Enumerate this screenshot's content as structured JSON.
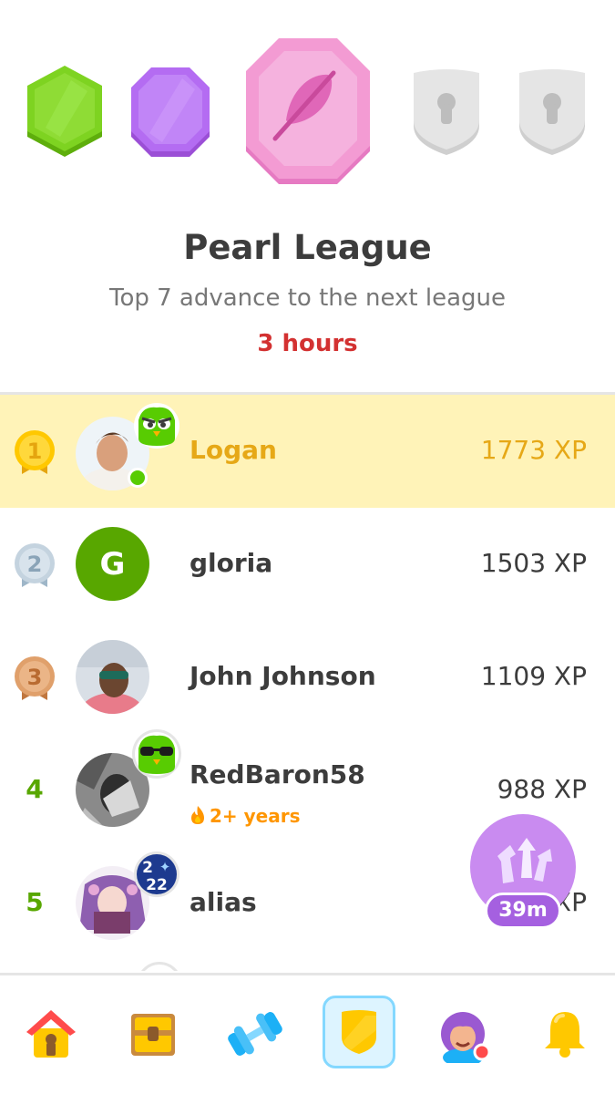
{
  "leagues": {
    "badges": [
      {
        "name": "emerald",
        "color": "#7ed321",
        "state": "completed"
      },
      {
        "name": "amethyst",
        "color": "#b46cf2",
        "state": "completed"
      },
      {
        "name": "pearl",
        "color": "#f39bd3",
        "state": "current",
        "icon": "feather-icon"
      },
      {
        "name": "locked-1",
        "color": "#e5e5e5",
        "state": "locked",
        "icon": "keyhole-icon"
      },
      {
        "name": "locked-2",
        "color": "#e5e5e5",
        "state": "locked",
        "icon": "keyhole-icon"
      }
    ]
  },
  "header": {
    "title": "Pearl League",
    "subtitle": "Top 7 advance to the next league",
    "time_left": "3 hours"
  },
  "leaderboard": [
    {
      "rank": "1",
      "rank_style": "gold-medal",
      "name": "Logan",
      "xp": "1773 XP",
      "is_me": true,
      "online": true,
      "badge": "duo-owl-icon"
    },
    {
      "rank": "2",
      "rank_style": "silver-medal",
      "name": "gloria",
      "xp": "1503 XP",
      "avatar_letter": "G",
      "avatar_color": "#58a700"
    },
    {
      "rank": "3",
      "rank_style": "bronze-medal",
      "name": "John Johnson",
      "xp": "1109 XP"
    },
    {
      "rank": "4",
      "name": "RedBaron58",
      "xp": "988 XP",
      "streak": "2+ years",
      "badge": "duo-sunglasses-icon"
    },
    {
      "rank": "5",
      "name": "alias",
      "xp": "XP",
      "badge": "year-2022-icon",
      "badge_text": [
        "2",
        "✦",
        "22"
      ]
    }
  ],
  "boost": {
    "label": "39m",
    "icon": "xp-boost-icon"
  },
  "nav": {
    "items": [
      {
        "name": "home",
        "icon": "house-icon"
      },
      {
        "name": "stories",
        "icon": "treasure-chest-icon"
      },
      {
        "name": "practice",
        "icon": "dumbbell-icon"
      },
      {
        "name": "leagues",
        "icon": "shield-icon",
        "active": true
      },
      {
        "name": "profile",
        "icon": "profile-avatar-icon"
      },
      {
        "name": "notifications",
        "icon": "bell-icon"
      }
    ]
  }
}
